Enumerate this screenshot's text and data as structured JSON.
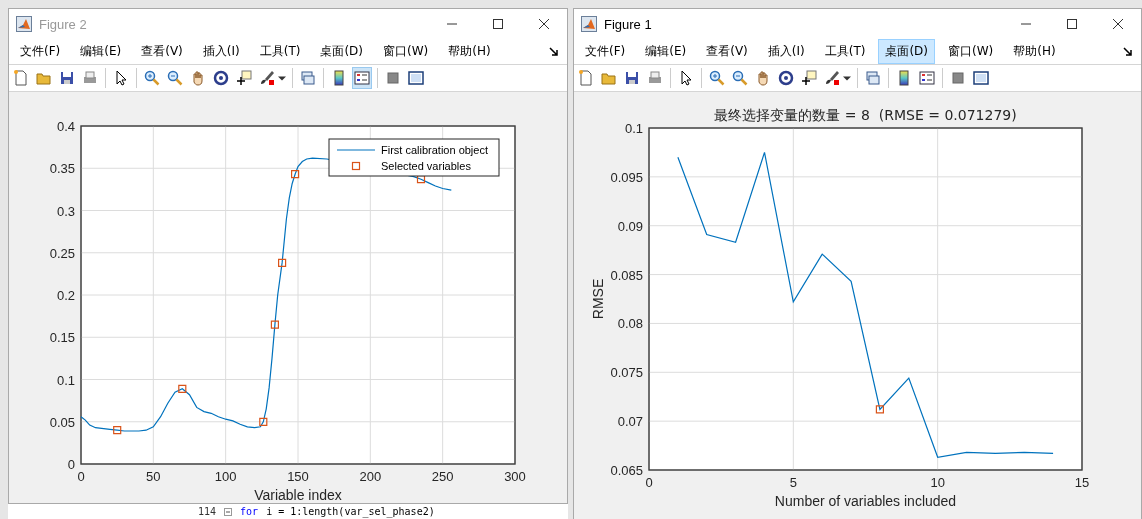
{
  "windows": [
    {
      "title": "Figure 2",
      "active": false,
      "menu": [
        {
          "label": "文件(F)",
          "selected": false
        },
        {
          "label": "编辑(E)",
          "selected": false
        },
        {
          "label": "查看(V)",
          "selected": false
        },
        {
          "label": "插入(I)",
          "selected": false
        },
        {
          "label": "工具(T)",
          "selected": false
        },
        {
          "label": "桌面(D)",
          "selected": false
        },
        {
          "label": "窗口(W)",
          "selected": false
        },
        {
          "label": "帮助(H)",
          "selected": false
        }
      ],
      "legend_button": {
        "selected": true
      },
      "chart_data": {
        "type": "line",
        "xlabel": "Variable index",
        "xlim": [
          0,
          300
        ],
        "ylim": [
          0,
          0.4
        ],
        "xticks": [
          0,
          50,
          100,
          150,
          200,
          250,
          300
        ],
        "yticks": [
          0,
          0.05,
          0.1,
          0.15,
          0.2,
          0.25,
          0.3,
          0.35,
          0.4
        ],
        "legend": true,
        "grid": true,
        "x": [
          0,
          3,
          6,
          10,
          20,
          25,
          30,
          40,
          45,
          50,
          55,
          60,
          65,
          70,
          75,
          80,
          85,
          90,
          95,
          100,
          105,
          110,
          115,
          120,
          124,
          126,
          128,
          130,
          132,
          134,
          136,
          139,
          142,
          144,
          146,
          148,
          150,
          153,
          156,
          160,
          170,
          230,
          235,
          240,
          245,
          250,
          256
        ],
        "series": [
          {
            "name": "First calibration object",
            "color": "#0072bd",
            "values": [
              0.056,
              0.052,
              0.046,
              0.043,
              0.041,
              0.04,
              0.039,
              0.039,
              0.04,
              0.044,
              0.056,
              0.072,
              0.085,
              0.089,
              0.082,
              0.067,
              0.062,
              0.06,
              0.056,
              0.053,
              0.051,
              0.047,
              0.044,
              0.043,
              0.044,
              0.05,
              0.065,
              0.09,
              0.125,
              0.165,
              0.2,
              0.238,
              0.29,
              0.315,
              0.332,
              0.343,
              0.352,
              0.358,
              0.361,
              0.362,
              0.361,
              0.34,
              0.337,
              0.333,
              0.329,
              0.326,
              0.324
            ]
          },
          {
            "name": "Selected variables",
            "type": "scatter",
            "marker": "square",
            "color": "#d95319",
            "values": [
              null,
              null,
              null,
              null,
              null,
              0.04,
              null,
              null,
              null,
              null,
              null,
              null,
              null,
              0.089,
              null,
              null,
              null,
              null,
              null,
              null,
              null,
              null,
              null,
              null,
              null,
              0.05,
              null,
              null,
              null,
              0.165,
              null,
              0.238,
              null,
              null,
              null,
              0.343,
              null,
              null,
              null,
              null,
              null,
              null,
              0.337,
              null,
              null,
              null,
              null
            ]
          }
        ]
      }
    },
    {
      "title": "Figure 1",
      "active": true,
      "menu": [
        {
          "label": "文件(F)",
          "selected": false
        },
        {
          "label": "编辑(E)",
          "selected": false
        },
        {
          "label": "查看(V)",
          "selected": false
        },
        {
          "label": "插入(I)",
          "selected": false
        },
        {
          "label": "工具(T)",
          "selected": false
        },
        {
          "label": "桌面(D)",
          "selected": true
        },
        {
          "label": "窗口(W)",
          "selected": false
        },
        {
          "label": "帮助(H)",
          "selected": false
        }
      ],
      "legend_button": {
        "selected": false
      },
      "chart_data": {
        "type": "line",
        "title": "最终选择变量的数量 = 8  (RMSE = 0.071279)",
        "xlabel": "Number of variables included",
        "ylabel": "RMSE",
        "xlim": [
          0,
          15
        ],
        "ylim": [
          0.065,
          0.1
        ],
        "xticks": [
          0,
          5,
          10,
          15
        ],
        "yticks": [
          0.065,
          0.07,
          0.075,
          0.08,
          0.085,
          0.09,
          0.095,
          0.1
        ],
        "legend": false,
        "grid": true,
        "x": [
          1,
          2,
          3,
          4,
          5,
          6,
          7,
          8,
          9,
          10,
          11,
          12,
          13,
          14
        ],
        "series": [
          {
            "color": "#0072bd",
            "values": [
              0.097,
              0.0891,
              0.0883,
              0.0975,
              0.0822,
              0.0871,
              0.0843,
              0.0712,
              0.0744,
              0.0663,
              0.0668,
              0.0667,
              0.0668,
              0.0667
            ]
          },
          {
            "type": "scatter",
            "marker": "square",
            "color": "#d95319",
            "values": [
              null,
              null,
              null,
              null,
              null,
              null,
              null,
              0.0712,
              null,
              null,
              null,
              null,
              null,
              null
            ]
          }
        ]
      }
    }
  ],
  "code_line": {
    "number": "114",
    "keyword": "for",
    "text": "i = 1:length(var_sel_phase2)"
  }
}
